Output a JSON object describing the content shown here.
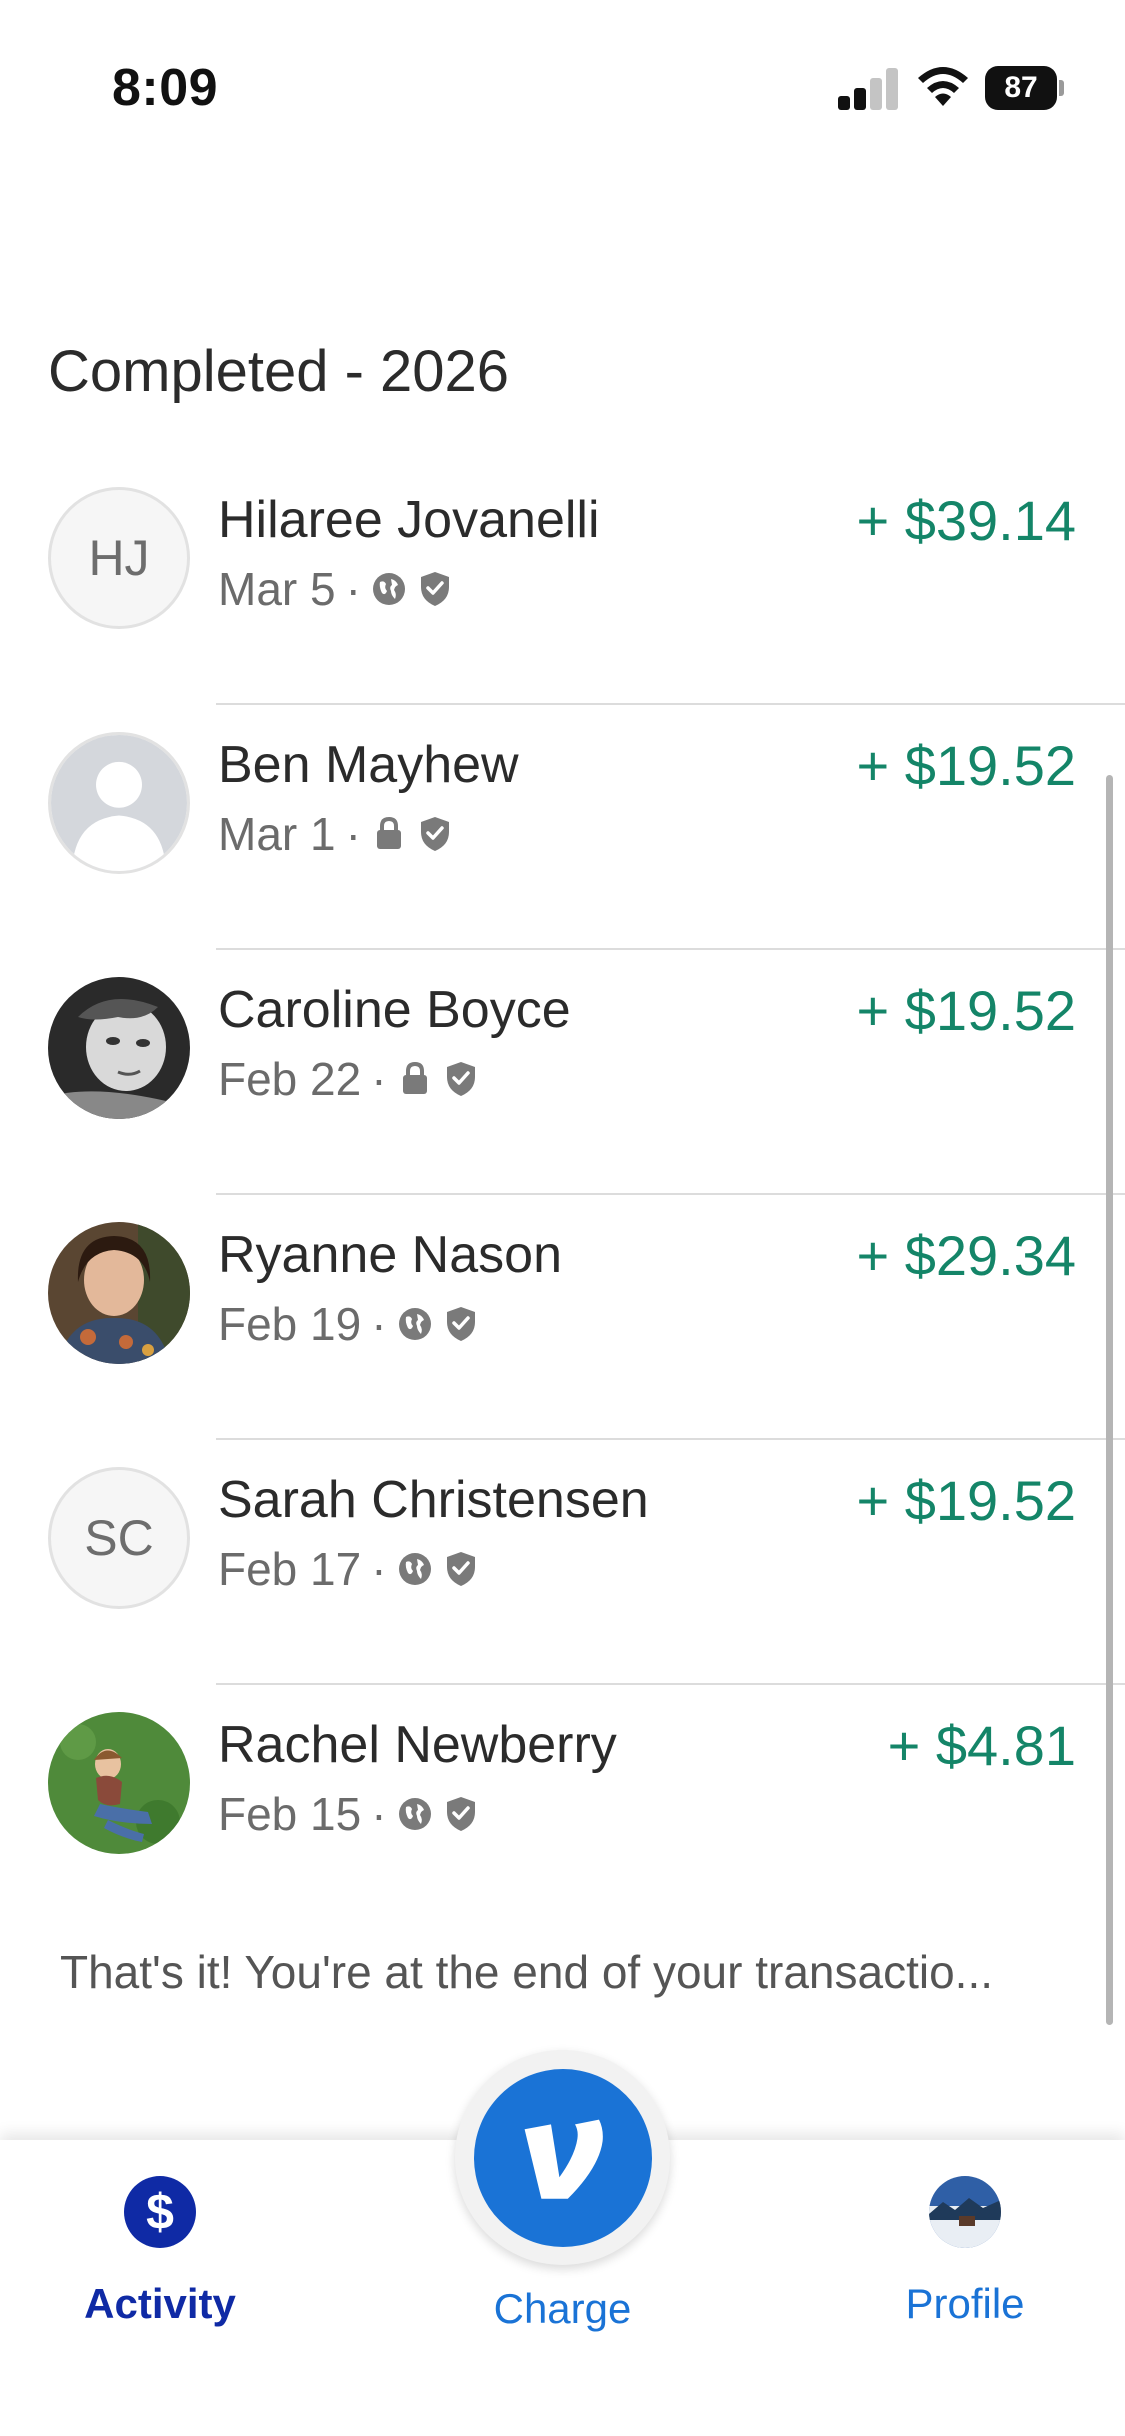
{
  "status_bar": {
    "time": "8:09",
    "battery": "87"
  },
  "section_title": "Completed - 2026",
  "transactions": [
    {
      "name": "Hilaree Jovanelli",
      "initials": "HJ",
      "date": "Mar 5",
      "privacy": "globe-icon",
      "amount": "+ $39.14"
    },
    {
      "name": "Ben Mayhew",
      "initials": "",
      "date": "Mar 1",
      "privacy": "lock-icon",
      "amount": "+ $19.52"
    },
    {
      "name": "Caroline Boyce",
      "initials": "",
      "date": "Feb 22",
      "privacy": "lock-icon",
      "amount": "+ $19.52"
    },
    {
      "name": "Ryanne Nason",
      "initials": "",
      "date": "Feb 19",
      "privacy": "globe-icon",
      "amount": "+ $29.34"
    },
    {
      "name": "Sarah Christensen",
      "initials": "SC",
      "date": "Feb 17",
      "privacy": "globe-icon",
      "amount": "+ $19.52"
    },
    {
      "name": "Rachel Newberry",
      "initials": "",
      "date": "Feb 15",
      "privacy": "globe-icon",
      "amount": "+ $4.81"
    }
  ],
  "meta_separator": "·",
  "end_note": "That's it! You're at the end of your transactio...",
  "nav": {
    "activity_label": "Activity",
    "activity_icon_glyph": "$",
    "charge_label": "Charge",
    "charge_glyph": "V",
    "profile_label": "Profile"
  },
  "colors": {
    "amount_positive": "#148568",
    "venmo_blue": "#1a73d6",
    "activity_navy": "#0f2aa5"
  }
}
